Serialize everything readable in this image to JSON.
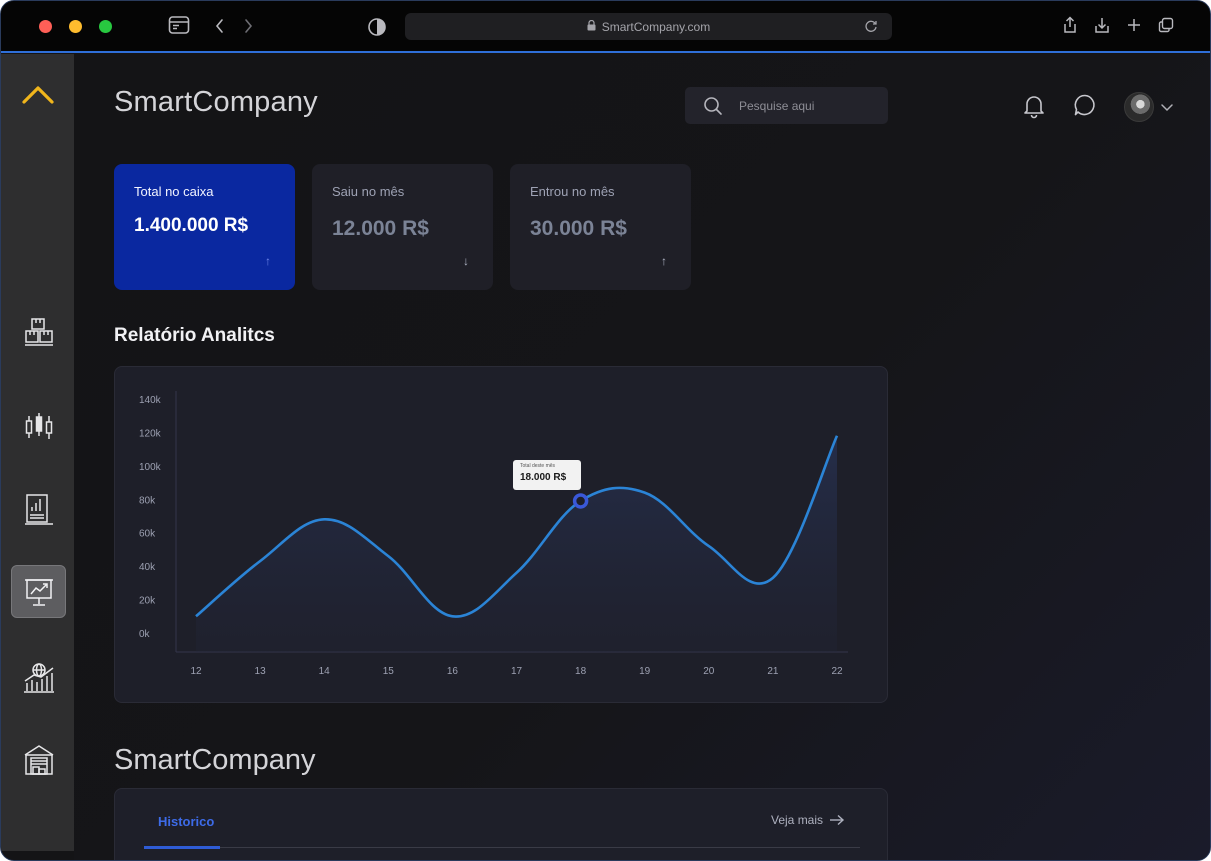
{
  "browser": {
    "url": "SmartCompany.com"
  },
  "header": {
    "brand": "SmartCompany",
    "search_placeholder": "Pesquise aqui"
  },
  "stats": [
    {
      "label": "Total no caixa",
      "value": "1.400.000 R$",
      "arrow": "↑"
    },
    {
      "label": "Saiu no mês",
      "value": "12.000 R$",
      "arrow": "↓"
    },
    {
      "label": "Entrou no mês",
      "value": "30.000 R$",
      "arrow": "↑"
    }
  ],
  "analytics": {
    "title": "Relatório Analitcs",
    "tooltip": {
      "title": "Total deste mês",
      "value": "18.000 R$"
    }
  },
  "chart_data": {
    "type": "area",
    "x": [
      "12",
      "13",
      "14",
      "15",
      "16",
      "17",
      "18",
      "19",
      "20",
      "21",
      "22"
    ],
    "y_ticks": [
      "0k",
      "20k",
      "40k",
      "60k",
      "80k",
      "100k",
      "120k",
      "140k"
    ],
    "ylim": [
      0,
      140000
    ],
    "series": [
      {
        "values": [
          10000,
          43000,
          68000,
          46000,
          10000,
          36000,
          79000,
          84000,
          52000,
          33000,
          118000
        ]
      }
    ],
    "highlight": {
      "x": "18",
      "y": 79000
    },
    "grid": false,
    "line_color": "#2b84d6"
  },
  "history": {
    "brand": "SmartCompany",
    "tab_label": "Historico",
    "see_more": "Veja mais"
  },
  "colors": {
    "accent": "#0a28a0",
    "link": "#3d6be8",
    "collapse_chevron": "#f0b51c"
  }
}
